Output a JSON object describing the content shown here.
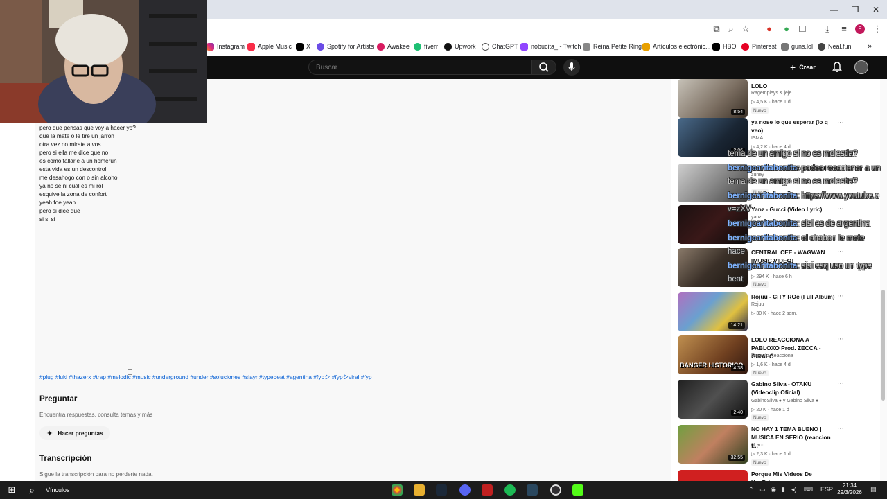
{
  "browser": {
    "bookmarks": [
      "Instagram",
      "Apple Music",
      "X",
      "Spotify for Artists",
      "Awakee",
      "fiverr",
      "Upwork",
      "ChatGPT",
      "nobucita_ - Twitch",
      "Reina Petite Ring",
      "Artículos electrónic...",
      "HBO",
      "Pinterest",
      "guns.lol",
      "Neal.fun"
    ],
    "profile_initial": "F"
  },
  "youtube": {
    "search_placeholder": "Buscar",
    "create_label": "Crear"
  },
  "main": {
    "lyrics": [
      "pero que pensas que voy a hacer yo?",
      "que la mate o le tire un jarron",
      "otra vez no mirate a vos",
      "pero si ella me dice que no",
      "es como fallarle a un homerun",
      "esta vida es un descontrol",
      "me desahogo con o sin alcohol",
      "ya no se ni cual es mi rol",
      "esquive la zona de confort",
      "yeah foe yeah",
      "pero si dice que",
      "si si si"
    ],
    "hashtags": "#plug #luki #thazerx #trap #melodic #music #underground #under #soluciones #slayr #typebeat #agentina #fypシ #fypシviral #fyp",
    "ask_title": "Preguntar",
    "ask_subtitle": "Encuentra respuestas, consulta temas y más",
    "ask_button": "Hacer preguntas",
    "transcript_title": "Transcripción",
    "transcript_subtitle": "Sigue la transcripción para no perderte nada."
  },
  "sidebar": {
    "videos": [
      {
        "title": "LOLO",
        "channel": "Ragempleys & jeje",
        "views": "4,5 K",
        "age": "hace 1 d",
        "duration": "8:54",
        "badge": "Nuevo"
      },
      {
        "title": "ya nose lo que esperar (lo q veo)",
        "channel": "ISMA",
        "views": "4,2 K",
        "age": "hace 4 d",
        "duration": "2:06",
        "badge": "Nuevo"
      },
      {
        "title": "zell - azul (version cumbia)",
        "channel": "zuney",
        "views": "",
        "age": "",
        "duration": "",
        "badge": "Nuevo"
      },
      {
        "title": "Yanz - Gucci (Video Lyric)",
        "channel": "yanz",
        "views": "",
        "age": "",
        "duration": "",
        "badge": ""
      },
      {
        "title": "CENTRAL CEE - WAGWAN [MUSIC VIDEO]",
        "channel": "",
        "views": "294 K",
        "age": "hace 6 h",
        "duration": "",
        "badge": "Nuevo"
      },
      {
        "title": "Rojuu - CiTY ROc (Full Album)",
        "channel": "Rojuu",
        "views": "30 K",
        "age": "hace 2 sem.",
        "duration": "14:21",
        "badge": ""
      },
      {
        "title": "LOLO REACCIONA A PABLOXO Prod. ZECCA - GIRALO",
        "channel": "Rageylo Reacciona",
        "views": "1,6 K",
        "age": "hace 4 d",
        "duration": "4:38",
        "badge": "Nuevo"
      },
      {
        "title": "Gabino Silva - OTAKU (Videoclip Oficial)",
        "channel": "GabinoSilva",
        "channel2": "y Gabino Silva",
        "views": "20 K",
        "age": "hace 1 d",
        "duration": "2:40",
        "badge": "Nuevo"
      },
      {
        "title": "NO HAY 1 TEMA BUENO | MUSICA EN SERIO (reaccion f...",
        "channel": "0Laco",
        "views": "2,3 K",
        "age": "hace 1 d",
        "duration": "32:55",
        "badge": "Nuevo"
      },
      {
        "title": "Porque Mis Videos De YouTube",
        "channel": "",
        "views": "",
        "age": "",
        "duration": "",
        "badge": ""
      }
    ],
    "thumb_texts": {
      "banger": "BANGER HISTORICO"
    }
  },
  "chat_overlay": [
    {
      "user": "",
      "text": "tema de un amigo si no es molestia?"
    },
    {
      "user": "bernigcaritabonita",
      "text": ": podes reaccionar a un"
    },
    {
      "user": "",
      "text": "tema de un amigo si no es molestia?"
    },
    {
      "user": "bernigcaritabonita",
      "text": ": https://www.youtube.c"
    },
    {
      "user": "bernigcaritabonita",
      "text": ": sisi es de argentina"
    },
    {
      "user": "bernigcaritabonita",
      "text": ": el chabon le mete"
    },
    {
      "user": "bernigcaritabonita",
      "text": ": sisi esq uso un type"
    },
    {
      "user": "",
      "text": "beat"
    }
  ],
  "chat_misc": {
    "vz": "v=zXV",
    "hace": "hace"
  },
  "taskbar": {
    "search_label": "Vínculos",
    "lang": "ESP",
    "time": "21:34",
    "date": "29/3/2026"
  },
  "colors": {
    "accent": "#065fd4",
    "yt_dark": "#0f0f0f",
    "chat_user": "#7fb3ff"
  }
}
